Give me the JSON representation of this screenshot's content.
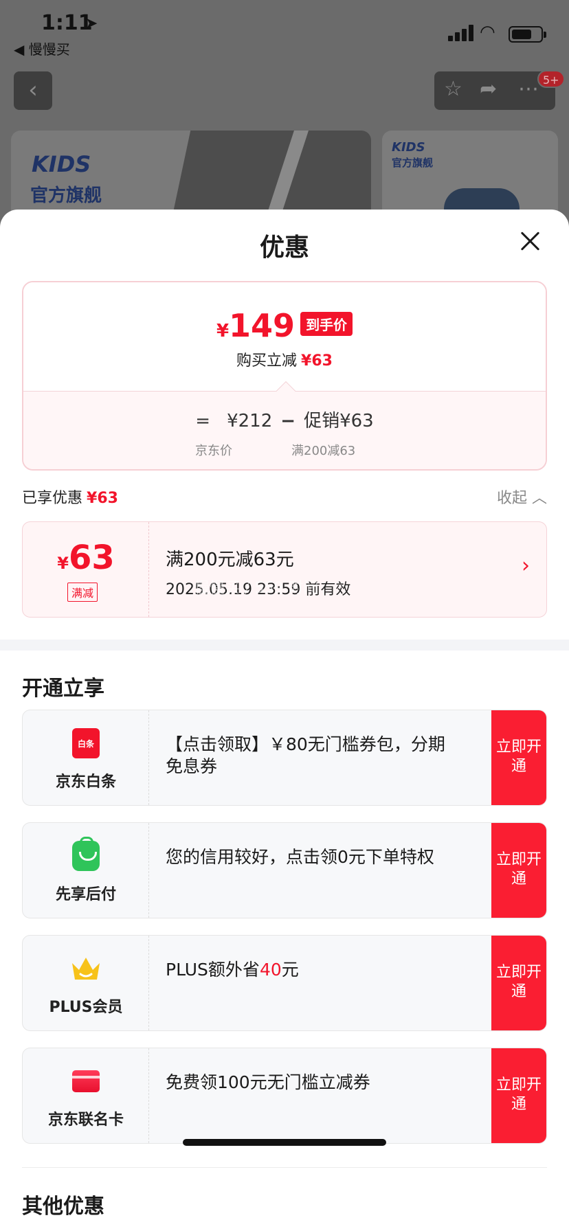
{
  "status_bar": {
    "time": "1:11",
    "back_app": "◀ 慢慢买"
  },
  "background": {
    "badge": "5+",
    "banner_logo": "KIDS",
    "banner_brand": "官方旗舰"
  },
  "sheet": {
    "title": "优惠",
    "price_card": {
      "currency": "¥",
      "final_price": "149",
      "final_tag": "到手价",
      "discount_label": "购买立减",
      "discount_value": "¥63",
      "formula_eq": "=",
      "jd_price": "¥212",
      "formula_minus": "−",
      "promo_label": "促销¥63",
      "jd_price_label": "京东价",
      "promo_detail": "满200减63"
    },
    "enjoyed": {
      "label": "已享优惠",
      "value": "¥63",
      "collapse": "收起"
    },
    "coupon": {
      "currency": "¥",
      "amount": "63",
      "type": "满减",
      "title": "满200元减63元",
      "date": "2025.05.19 23:59 前有效",
      "watermark": "慢慢买 / 559 时间"
    },
    "open_section_title": "开通立享",
    "services": [
      {
        "icon": "baitiao-icon",
        "name": "京东白条",
        "desc": "【点击领取】￥80无门槛券包，分期免息券",
        "btn": "立即开通"
      },
      {
        "icon": "bag-icon",
        "name": "先享后付",
        "desc": "您的信用较好，点击领0元下单特权",
        "btn": "立即开通"
      },
      {
        "icon": "crown-icon",
        "name": "PLUS会员",
        "desc_prefix": "PLUS额外省",
        "desc_amount": "40",
        "desc_suffix": "元",
        "btn": "立即开通"
      },
      {
        "icon": "card-icon",
        "name": "京东联名卡",
        "desc": "免费领100元无门槛立减券",
        "btn": "立即开通"
      }
    ],
    "other_section_title": "其他优惠"
  },
  "colors": {
    "accent_red": "#f2142b",
    "button_red": "#fa1e32",
    "crown_yellow": "#f7c21a",
    "bag_green": "#2fc45a"
  }
}
